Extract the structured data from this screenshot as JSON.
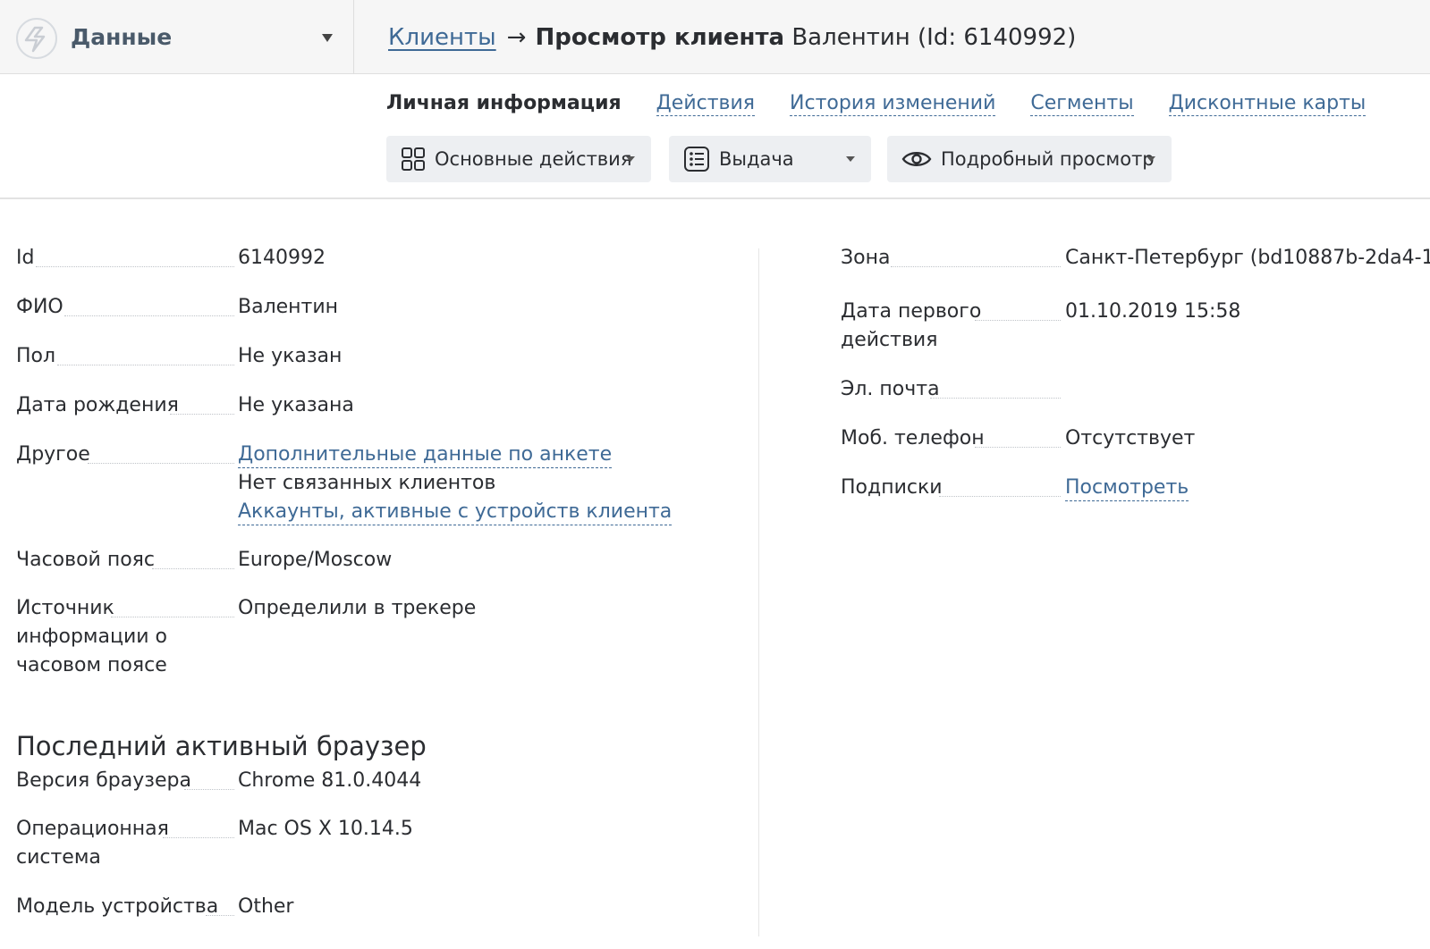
{
  "header": {
    "section_name": "Данные",
    "breadcrumb_link": "Клиенты",
    "breadcrumb_arrow": "→",
    "page_title": "Просмотр клиента",
    "page_subtitle": "Валентин (Id: 6140992)"
  },
  "tabs": [
    {
      "label": "Личная информация",
      "active": true
    },
    {
      "label": "Действия",
      "active": false
    },
    {
      "label": "История изменений",
      "active": false
    },
    {
      "label": "Сегменты",
      "active": false
    },
    {
      "label": "Дисконтные карты",
      "active": false
    }
  ],
  "toolbar": {
    "main_actions": "Основные действия",
    "issue": "Выдача",
    "detailed_view": "Подробный просмотр"
  },
  "left_fields": {
    "id": {
      "label": "Id",
      "value": "6140992"
    },
    "name": {
      "label": "ФИО",
      "value": "Валентин"
    },
    "gender": {
      "label": "Пол",
      "value": "Не указан"
    },
    "birthdate": {
      "label": "Дата рождения",
      "value": "Не указана"
    },
    "other": {
      "label": "Другое",
      "link1": "Дополнительные данные по анкете",
      "text": "Нет связанных клиентов",
      "link2": "Аккаунты, активные с устройств клиента"
    },
    "timezone": {
      "label": "Часовой пояс",
      "value": "Europe/Moscow"
    },
    "tz_source": {
      "label_line1": "Источник",
      "label_line2": "информации о",
      "label_line3": "часовом поясе",
      "value": "Определили в трекере"
    }
  },
  "browser_section": {
    "heading": "Последний активный браузер",
    "browser_version": {
      "label": "Версия браузера",
      "value": "Chrome 81.0.4044"
    },
    "os": {
      "label_line1": "Операционная",
      "label_line2": "система",
      "value": "Mac OS X 10.14.5"
    },
    "device": {
      "label": "Модель устройства",
      "value": "Other"
    }
  },
  "right_fields": {
    "zone": {
      "label": "Зона",
      "value": "Санкт-Петербург (bd10887b-2da4-1"
    },
    "first_action": {
      "label_line1": "Дата первого",
      "label_line2": "действия",
      "value": "01.10.2019 15:58"
    },
    "email": {
      "label": "Эл. почта",
      "value": ""
    },
    "phone": {
      "label": "Моб. телефон",
      "value": "Отсутствует"
    },
    "subscriptions": {
      "label": "Подписки",
      "value": "Посмотреть"
    }
  },
  "colors": {
    "link": "#3f6a96",
    "text": "#2b2d31",
    "topbar_bg": "#f6f6f6",
    "button_bg": "#edeff2"
  }
}
